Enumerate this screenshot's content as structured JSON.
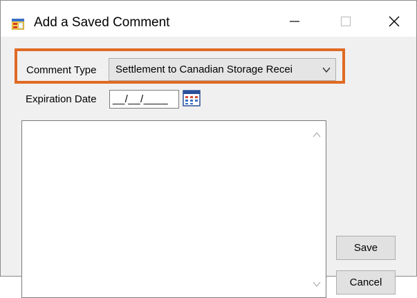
{
  "window": {
    "title": "Add a Saved Comment"
  },
  "form": {
    "comment_type_label": "Comment Type",
    "comment_type_value": "Settlement to Canadian Storage Recei",
    "expiration_date_label": "Expiration Date",
    "expiration_date_value": "__/__/____",
    "comment_text": ""
  },
  "buttons": {
    "save": "Save",
    "cancel": "Cancel"
  },
  "icons": {
    "app": "app-form-icon",
    "minimize": "minimize-icon",
    "maximize": "maximize-icon",
    "close": "close-icon",
    "combo_arrow": "chevron-down-icon",
    "calendar": "calendar-icon",
    "scroll_up": "scroll-up-icon",
    "scroll_down": "scroll-down-icon"
  },
  "colors": {
    "highlight": "#e06a24",
    "window_bg": "#f0f0f0",
    "titlebar_bg": "#ffffff"
  }
}
